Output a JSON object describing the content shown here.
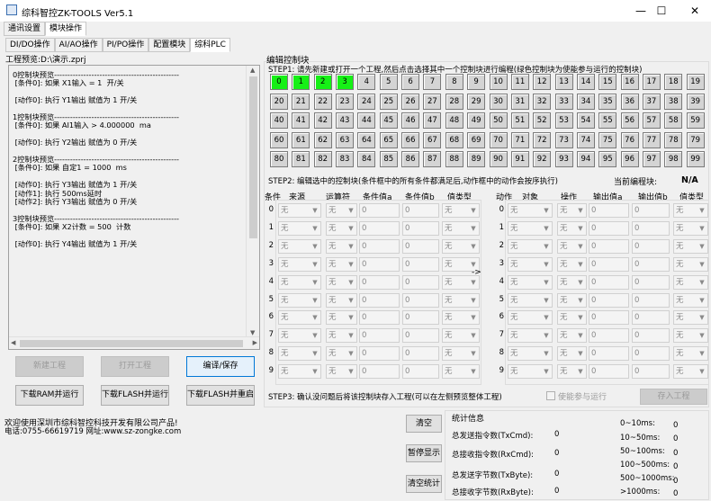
{
  "window": {
    "title": "综科智控ZK-TOOLS Ver5.1",
    "minimize": "—",
    "maximize": "☐",
    "close": "✕"
  },
  "top_tabs": [
    "通讯设置",
    "模块操作"
  ],
  "sub_tabs": [
    "DI/DO操作",
    "AI/AO操作",
    "PI/PO操作",
    "配置模块",
    "综科PLC"
  ],
  "left": {
    "project_path": "工程预览:D:\\演示.zprj",
    "preview_text": "0控制块预览-----------------------------------------------\n [条件0]: 如果 X1输入 = 1  开/关\n\n [动作0]: 执行 Y1输出 赋值为 1 开/关\n\n1控制块预览-----------------------------------------------\n [条件0]: 如果 AI1输入 > 4.000000  ma\n\n [动作0]: 执行 Y2输出 赋值为 0 开/关\n\n2控制块预览-----------------------------------------------\n [条件0]: 如果 自定1 = 1000  ms\n\n [动作0]: 执行 Y3输出 赋值为 1 开/关\n [动作1]: 执行 500ms延时\n [动作2]: 执行 Y3输出 赋值为 0 开/关\n\n3控制块预览-----------------------------------------------\n [条件0]: 如果 X2计数 = 500  计数\n\n [动作0]: 执行 Y4输出 赋值为 1 开/关",
    "buttons": {
      "new_project": "新建工程",
      "open_project": "打开工程",
      "compile_save": "编译/保存",
      "download_ram": "下载RAM并运行",
      "download_flash": "下载FLASH并运行",
      "download_flash_restart": "下载FLASH并重启"
    }
  },
  "editor": {
    "title": "编辑控制块",
    "step1": "STEP1: 请先新建或打开一个工程,然后点击选择其中一个控制块进行编程(绿色控制块为使能参与运行的控制块)",
    "blocks": [
      "0",
      "1",
      "2",
      "3",
      "4",
      "5",
      "6",
      "7",
      "8",
      "9",
      "10",
      "11",
      "12",
      "13",
      "14",
      "15",
      "16",
      "17",
      "18",
      "19",
      "20",
      "21",
      "22",
      "23",
      "24",
      "25",
      "26",
      "27",
      "28",
      "29",
      "30",
      "31",
      "32",
      "33",
      "34",
      "35",
      "36",
      "37",
      "38",
      "39",
      "40",
      "41",
      "42",
      "43",
      "44",
      "45",
      "46",
      "47",
      "48",
      "49",
      "50",
      "51",
      "52",
      "53",
      "54",
      "55",
      "56",
      "57",
      "58",
      "59",
      "60",
      "61",
      "62",
      "63",
      "64",
      "65",
      "66",
      "67",
      "68",
      "69",
      "70",
      "71",
      "72",
      "73",
      "74",
      "75",
      "76",
      "77",
      "78",
      "79",
      "80",
      "81",
      "82",
      "83",
      "84",
      "85",
      "86",
      "87",
      "88",
      "89",
      "90",
      "91",
      "92",
      "93",
      "94",
      "95",
      "96",
      "97",
      "98",
      "99"
    ],
    "enabled_blocks": [
      0,
      1,
      2,
      3
    ],
    "enabled_color": "#16f016",
    "step2": "STEP2: 编辑选中的控制块(条件框中的所有条件都满足后,动作框中的动作会按序执行)",
    "current_label": "当前编程块:",
    "current_value": "N/A",
    "cond_headers": [
      "条件",
      "来源",
      "运算符",
      "条件值a",
      "条件值b",
      "值类型"
    ],
    "action_headers": [
      "动作",
      "对象",
      "操作",
      "输出值a",
      "输出值b",
      "值类型"
    ],
    "rows": [
      "0",
      "1",
      "2",
      "3",
      "4",
      "5",
      "6",
      "7",
      "8",
      "9"
    ],
    "select_text": "无",
    "input_text": "0",
    "arrow": "->",
    "step3": "STEP3: 确认没问题后将该控制块存入工程(可以在左侧预览整体工程)",
    "enable_label": "使能参与运行",
    "save_button": "存入工程"
  },
  "footer": {
    "welcome": "欢迎使用深圳市综科智控科技开发有限公司产品!",
    "phone": "电话:0755-66619719 网址:www.sz-zongke.com",
    "clear": "清空",
    "pause": "暂停显示",
    "clear_stats": "清空统计"
  },
  "stats": {
    "title": "统计信息",
    "labels": [
      "总发送指令数(TxCmd):",
      "总接收指令数(RxCmd):",
      "总发送字节数(TxByte):",
      "总接收字节数(RxByte):"
    ],
    "values": [
      "0",
      "0",
      "0",
      "0"
    ],
    "range_labels": [
      "0~10ms:",
      "10~50ms:",
      "50~100ms:",
      "100~500ms:",
      "500~1000ms:",
      ">1000ms:"
    ],
    "range_values": [
      "0",
      "0",
      "0",
      "0",
      "0",
      "0"
    ]
  }
}
